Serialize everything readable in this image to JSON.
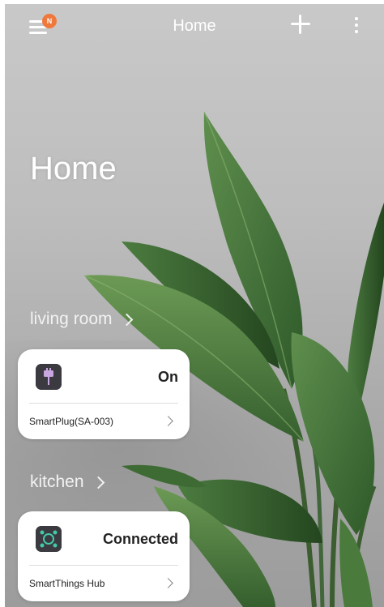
{
  "topbar": {
    "title": "Home",
    "badge": "N",
    "menu_icon": "hamburger-menu-icon",
    "add_icon": "plus-icon",
    "more_icon": "vertical-dots-icon"
  },
  "page": {
    "title": "Home"
  },
  "rooms": [
    {
      "name": "living room",
      "device": {
        "icon": "smart-plug-icon",
        "status": "On",
        "name": "SmartPlug(SA-003)"
      }
    },
    {
      "name": "kitchen",
      "device": {
        "icon": "smartthings-hub-icon",
        "status": "Connected",
        "name": "SmartThings Hub"
      }
    }
  ],
  "colors": {
    "badge": "#f0783c",
    "card_bg": "#ffffff",
    "text_light": "#ffffff",
    "hub_icon": "#44c9a8"
  }
}
